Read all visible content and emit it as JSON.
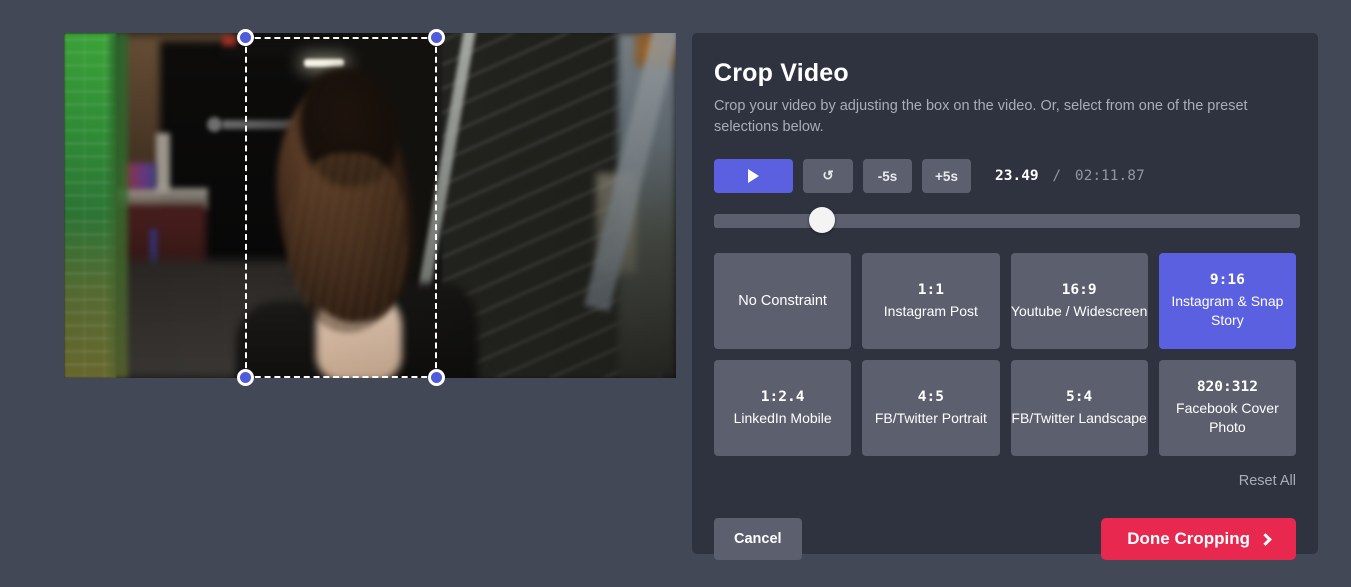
{
  "panel": {
    "title": "Crop Video",
    "subtitle": "Crop your video by adjusting the box on the video. Or, select from one of the preset selections below."
  },
  "playback": {
    "play_label": "play-icon",
    "restart_label": "↺",
    "back_label": "-5s",
    "forward_label": "+5s",
    "current_time": "23.49",
    "separator": "/",
    "total_time": "02:11.87",
    "slider_position_pct": 17
  },
  "presets": [
    {
      "ratio": "",
      "name": "No Constraint",
      "active": false
    },
    {
      "ratio": "1:1",
      "name": "Instagram Post",
      "active": false
    },
    {
      "ratio": "16:9",
      "name": "Youtube / Widescreen",
      "active": false
    },
    {
      "ratio": "9:16",
      "name": "Instagram & Snap Story",
      "active": true
    },
    {
      "ratio": "1:2.4",
      "name": "LinkedIn Mobile",
      "active": false
    },
    {
      "ratio": "4:5",
      "name": "FB/Twitter Portrait",
      "active": false
    },
    {
      "ratio": "5:4",
      "name": "FB/Twitter Landscape",
      "active": false
    },
    {
      "ratio": "820:312",
      "name": "Facebook Cover Photo",
      "active": false
    }
  ],
  "reset": {
    "label": "Reset All"
  },
  "footer": {
    "cancel_label": "Cancel",
    "done_label": "Done Cropping"
  },
  "colors": {
    "page_background": "#434857",
    "panel_background": "#2f3340",
    "accent_indigo": "#5b60e0",
    "accent_crimson": "#e8284e",
    "button_grey": "#5c606e",
    "handle_blue": "#4f5bd8"
  }
}
